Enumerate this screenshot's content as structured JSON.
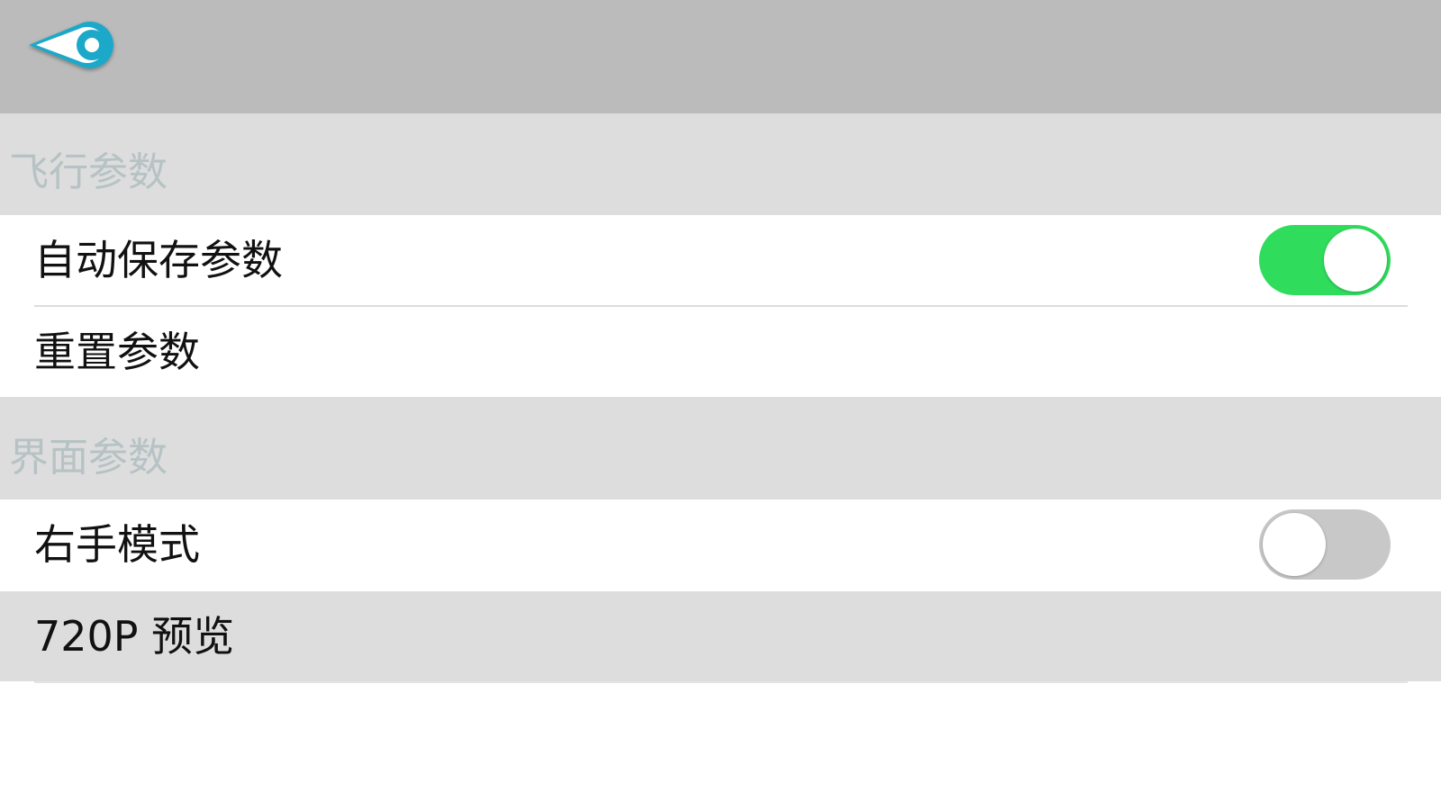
{
  "header": {
    "back_icon": "back-arrow-circle-icon"
  },
  "sections": [
    {
      "title": "飞行参数",
      "rows": [
        {
          "label": "自动保存参数",
          "toggle": true
        },
        {
          "label": "重置参数"
        }
      ]
    },
    {
      "title": "界面参数",
      "rows": [
        {
          "label": "右手模式",
          "toggle": false
        },
        {
          "label": "720P 预览"
        }
      ]
    }
  ],
  "colors": {
    "header_bg": "#bbbbbb",
    "section_bg": "#dddddd",
    "section_title": "#b6c2c4",
    "toggle_on": "#2fdc5c",
    "toggle_off": "#c8c8c8",
    "back_icon_accent": "#1fa8c9"
  }
}
